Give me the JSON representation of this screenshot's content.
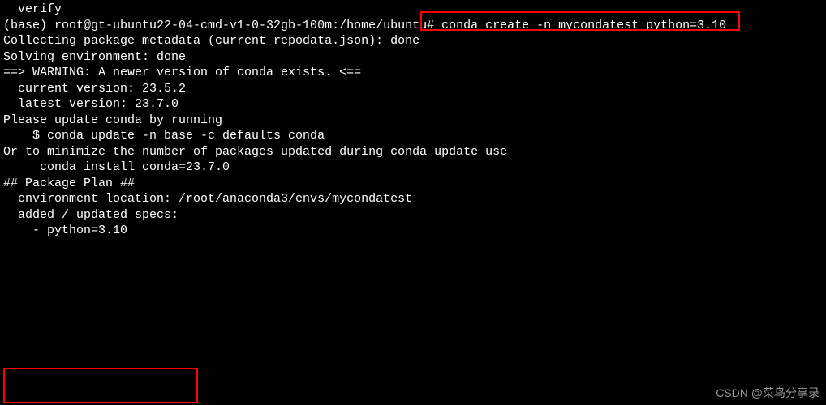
{
  "lines": {
    "l0": "  verify",
    "l1_prompt": "(base) root@gt-ubuntu22-04-cmd-v1-0-32gb-100m:/home/ubuntu# ",
    "l1_cmd": "conda create -n mycondatest python=3.10",
    "l2": "Collecting package metadata (current_repodata.json): done",
    "l3": "Solving environment: done",
    "l4": "",
    "l5": "",
    "l6": "==> WARNING: A newer version of conda exists. <==",
    "l7": "  current version: 23.5.2",
    "l8": "  latest version: 23.7.0",
    "l9": "",
    "l10": "Please update conda by running",
    "l11": "",
    "l12": "    $ conda update -n base -c defaults conda",
    "l13": "",
    "l14": "Or to minimize the number of packages updated during conda update use",
    "l15": "",
    "l16": "     conda install conda=23.7.0",
    "l17": "",
    "l18": "",
    "l19": "",
    "l20": "## Package Plan ##",
    "l21": "",
    "l22": "  environment location: /root/anaconda3/envs/mycondatest",
    "l23": "",
    "l24": "  added / updated specs:",
    "l25": "    - python=3.10"
  },
  "watermark": "CSDN @菜鸟分享录"
}
